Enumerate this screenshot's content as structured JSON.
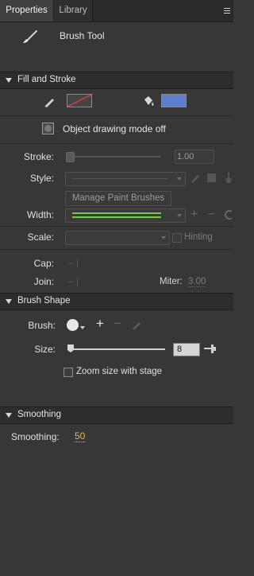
{
  "tabs": [
    {
      "label": "Properties"
    },
    {
      "label": "Library"
    }
  ],
  "tool": {
    "name": "Brush Tool"
  },
  "fill_stroke": {
    "title": "Fill and Stroke",
    "object_drawing": "Object drawing mode off",
    "stroke_label": "Stroke:",
    "stroke_value": "1.00",
    "style_label": "Style:",
    "manage_brushes": "Manage Paint Brushes",
    "width_label": "Width:",
    "scale_label": "Scale:",
    "hinting_label": "Hinting",
    "cap_label": "Cap:",
    "join_label": "Join:",
    "miter_label": "Miter:",
    "miter_value": "3.00",
    "colors": {
      "fill": "#5b7fcf",
      "stroke_swatch_line": "#d04040",
      "width_line": "#6fce3b"
    }
  },
  "brush_shape": {
    "title": "Brush Shape",
    "brush_label": "Brush:",
    "size_label": "Size:",
    "size_value": "8",
    "zoom_with_stage": "Zoom size with stage"
  },
  "smoothing": {
    "title": "Smoothing",
    "label": "Smoothing:",
    "value": "50"
  }
}
